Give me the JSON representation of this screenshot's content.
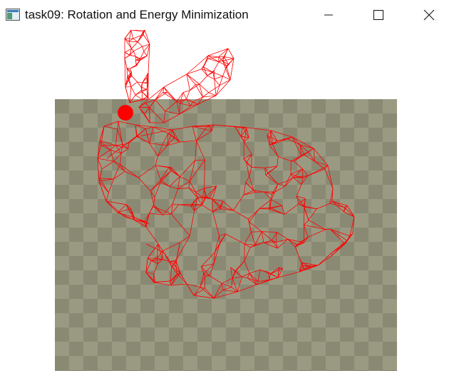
{
  "window": {
    "title": "task09: Rotation and Energy Minimization",
    "icons": {
      "app": "app-window-icon",
      "minimize": "minimize-icon",
      "maximize": "maximize-icon",
      "close": "close-icon"
    }
  },
  "viewport": {
    "checker_colors": [
      "#8a8a74",
      "#9a9a82"
    ],
    "mesh_color": "#ff0000",
    "handle_color": "#ff0000",
    "mesh_style": "wireframe",
    "model": "bunny"
  }
}
